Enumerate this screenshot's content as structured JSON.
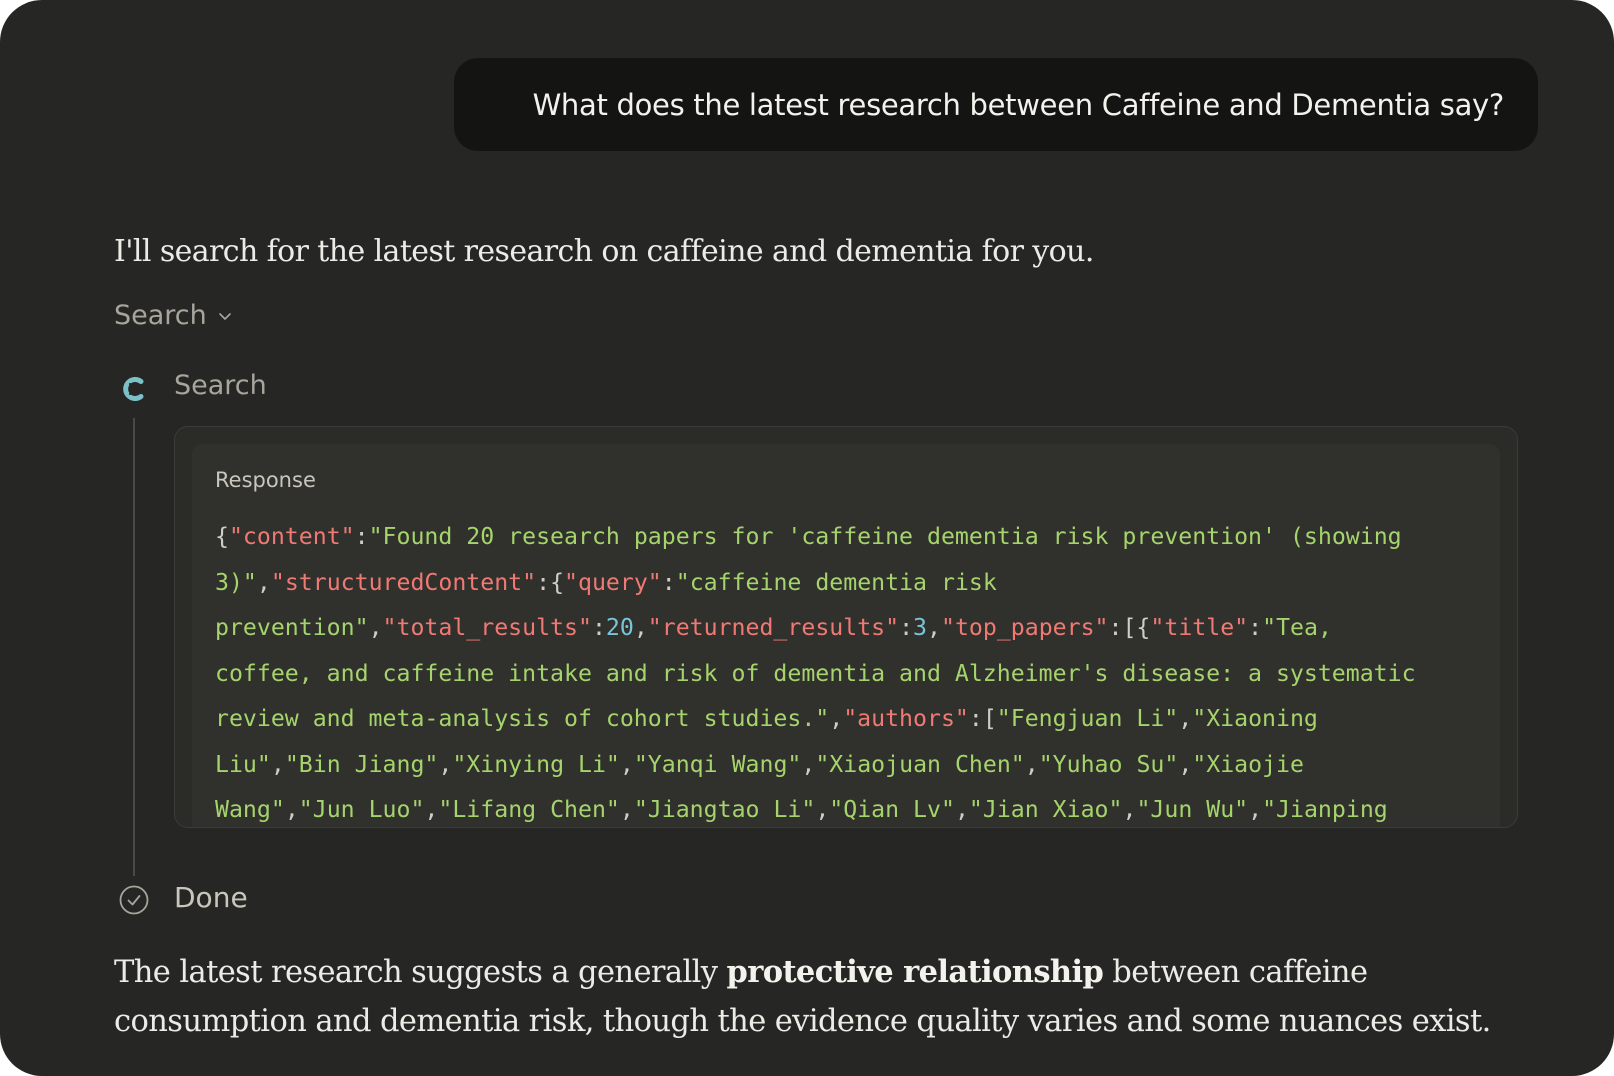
{
  "user_message": {
    "text": "What does the latest research between Caffeine and Dementia say?"
  },
  "assistant": {
    "intro": "I'll search for the latest research on caffeine and dementia for you.",
    "tool_toggle_label": "Search",
    "tool_step": {
      "label": "Search",
      "icon": "tool-logo-icon"
    },
    "response": {
      "title": "Response",
      "lines": [
        [
          {
            "t": "{",
            "c": "p"
          },
          {
            "t": "\"content\"",
            "c": "k"
          },
          {
            "t": ":",
            "c": "p"
          },
          {
            "t": "\"Found 20 research papers for 'caffeine dementia risk prevention' (showing",
            "c": "s"
          }
        ],
        [
          {
            "t": "3)\"",
            "c": "s"
          },
          {
            "t": ",",
            "c": "p"
          },
          {
            "t": "\"structuredContent\"",
            "c": "k"
          },
          {
            "t": ":{",
            "c": "p"
          },
          {
            "t": "\"query\"",
            "c": "k"
          },
          {
            "t": ":",
            "c": "p"
          },
          {
            "t": "\"caffeine dementia risk",
            "c": "s"
          }
        ],
        [
          {
            "t": "prevention\"",
            "c": "s"
          },
          {
            "t": ",",
            "c": "p"
          },
          {
            "t": "\"total_results\"",
            "c": "k"
          },
          {
            "t": ":",
            "c": "p"
          },
          {
            "t": "20",
            "c": "n"
          },
          {
            "t": ",",
            "c": "p"
          },
          {
            "t": "\"returned_results\"",
            "c": "k"
          },
          {
            "t": ":",
            "c": "p"
          },
          {
            "t": "3",
            "c": "n"
          },
          {
            "t": ",",
            "c": "p"
          },
          {
            "t": "\"top_papers\"",
            "c": "k"
          },
          {
            "t": ":[{",
            "c": "p"
          },
          {
            "t": "\"title\"",
            "c": "k"
          },
          {
            "t": ":",
            "c": "p"
          },
          {
            "t": "\"Tea,",
            "c": "s"
          }
        ],
        [
          {
            "t": "coffee, and caffeine intake and risk of dementia and Alzheimer's disease: a systematic",
            "c": "s"
          }
        ],
        [
          {
            "t": "review and meta-analysis of cohort studies.\"",
            "c": "s"
          },
          {
            "t": ",",
            "c": "p"
          },
          {
            "t": "\"authors\"",
            "c": "k"
          },
          {
            "t": ":[",
            "c": "p"
          },
          {
            "t": "\"Fengjuan Li\"",
            "c": "s"
          },
          {
            "t": ",",
            "c": "p"
          },
          {
            "t": "\"Xiaoning",
            "c": "s"
          }
        ],
        [
          {
            "t": "Liu\"",
            "c": "s"
          },
          {
            "t": ",",
            "c": "p"
          },
          {
            "t": "\"Bin Jiang\"",
            "c": "s"
          },
          {
            "t": ",",
            "c": "p"
          },
          {
            "t": "\"Xinying Li\"",
            "c": "s"
          },
          {
            "t": ",",
            "c": "p"
          },
          {
            "t": "\"Yanqi Wang\"",
            "c": "s"
          },
          {
            "t": ",",
            "c": "p"
          },
          {
            "t": "\"Xiaojuan Chen\"",
            "c": "s"
          },
          {
            "t": ",",
            "c": "p"
          },
          {
            "t": "\"Yuhao Su\"",
            "c": "s"
          },
          {
            "t": ",",
            "c": "p"
          },
          {
            "t": "\"Xiaojie",
            "c": "s"
          }
        ],
        [
          {
            "t": "Wang\"",
            "c": "s"
          },
          {
            "t": ",",
            "c": "p"
          },
          {
            "t": "\"Jun Luo\"",
            "c": "s"
          },
          {
            "t": ",",
            "c": "p"
          },
          {
            "t": "\"Lifang Chen\"",
            "c": "s"
          },
          {
            "t": ",",
            "c": "p"
          },
          {
            "t": "\"Jiangtao Li\"",
            "c": "s"
          },
          {
            "t": ",",
            "c": "p"
          },
          {
            "t": "\"Qian Lv\"",
            "c": "s"
          },
          {
            "t": ",",
            "c": "p"
          },
          {
            "t": "\"Jian Xiao\"",
            "c": "s"
          },
          {
            "t": ",",
            "c": "p"
          },
          {
            "t": "\"Jun Wu\"",
            "c": "s"
          },
          {
            "t": ",",
            "c": "p"
          },
          {
            "t": "\"Jianping",
            "c": "s"
          }
        ]
      ]
    },
    "done_label": "Done",
    "answer": {
      "before": "The latest research suggests a generally ",
      "bold": "protective relationship",
      "after": " between caffeine consumption and dementia risk, though the evidence quality varies and some nuances exist."
    }
  },
  "colors": {
    "background": "#262624",
    "user_bubble": "#141413",
    "json_key": "#f07a73",
    "json_string": "#a6d46c",
    "json_number": "#79c5d8",
    "tool_icon": "#7cc0c8"
  }
}
